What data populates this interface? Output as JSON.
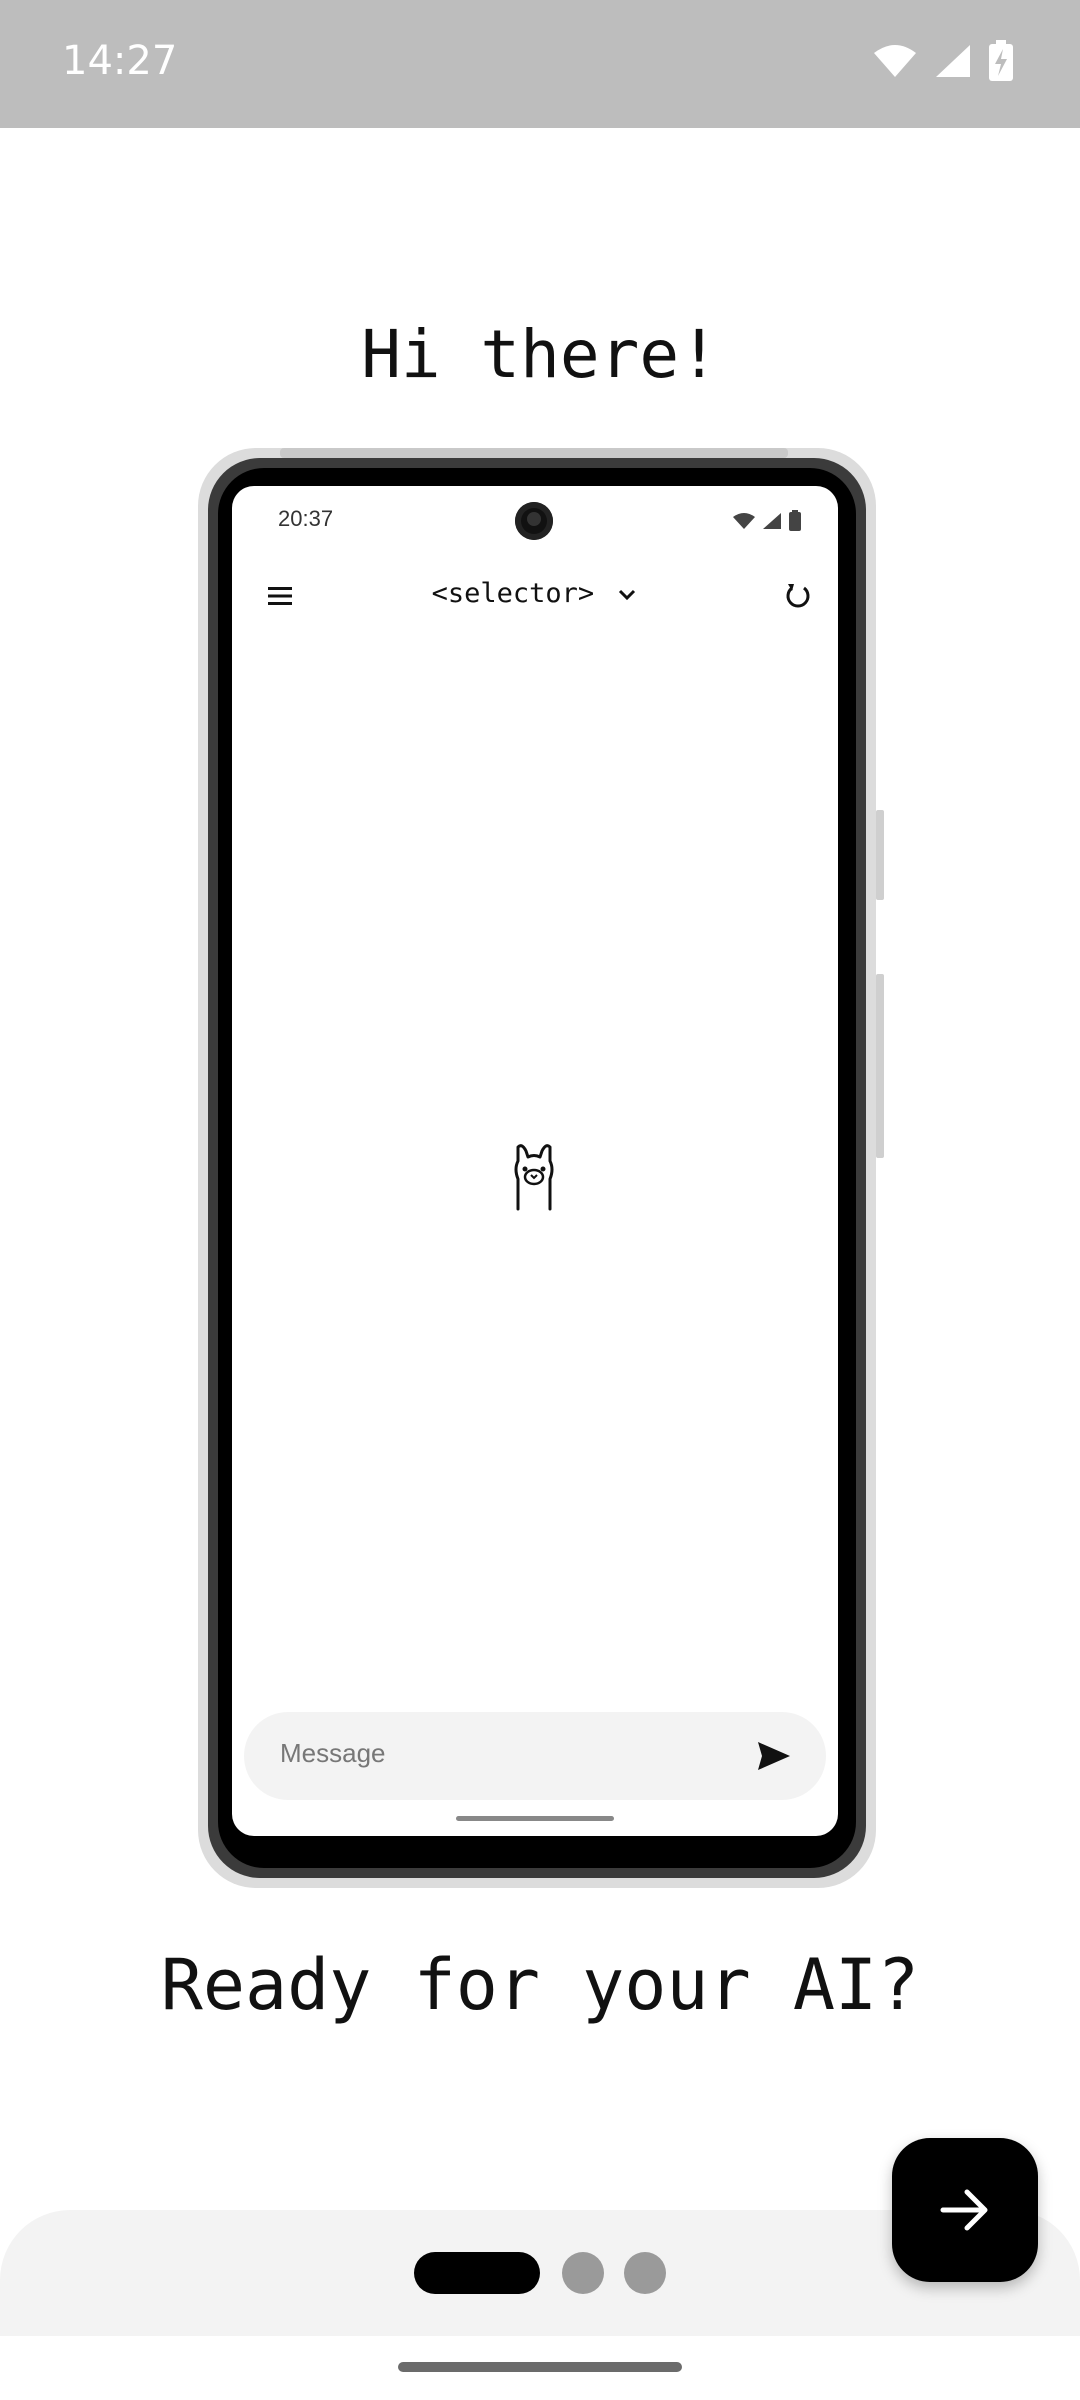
{
  "status_bar": {
    "time": "14:27",
    "icons": [
      "wifi-icon",
      "signal-icon",
      "battery-charging-icon"
    ]
  },
  "onboarding": {
    "greeting": "Hi there!",
    "tagline": "Ready for your AI?",
    "page_indicator": {
      "current": 1,
      "total": 3
    },
    "next_icon": "arrow-right-icon"
  },
  "preview": {
    "status_time": "20:37",
    "selector_label": "<selector>",
    "menu_icon": "menu-icon",
    "refresh_icon": "refresh-icon",
    "center_icon": "llama-icon",
    "message_placeholder": "Message",
    "send_icon": "send-icon"
  }
}
